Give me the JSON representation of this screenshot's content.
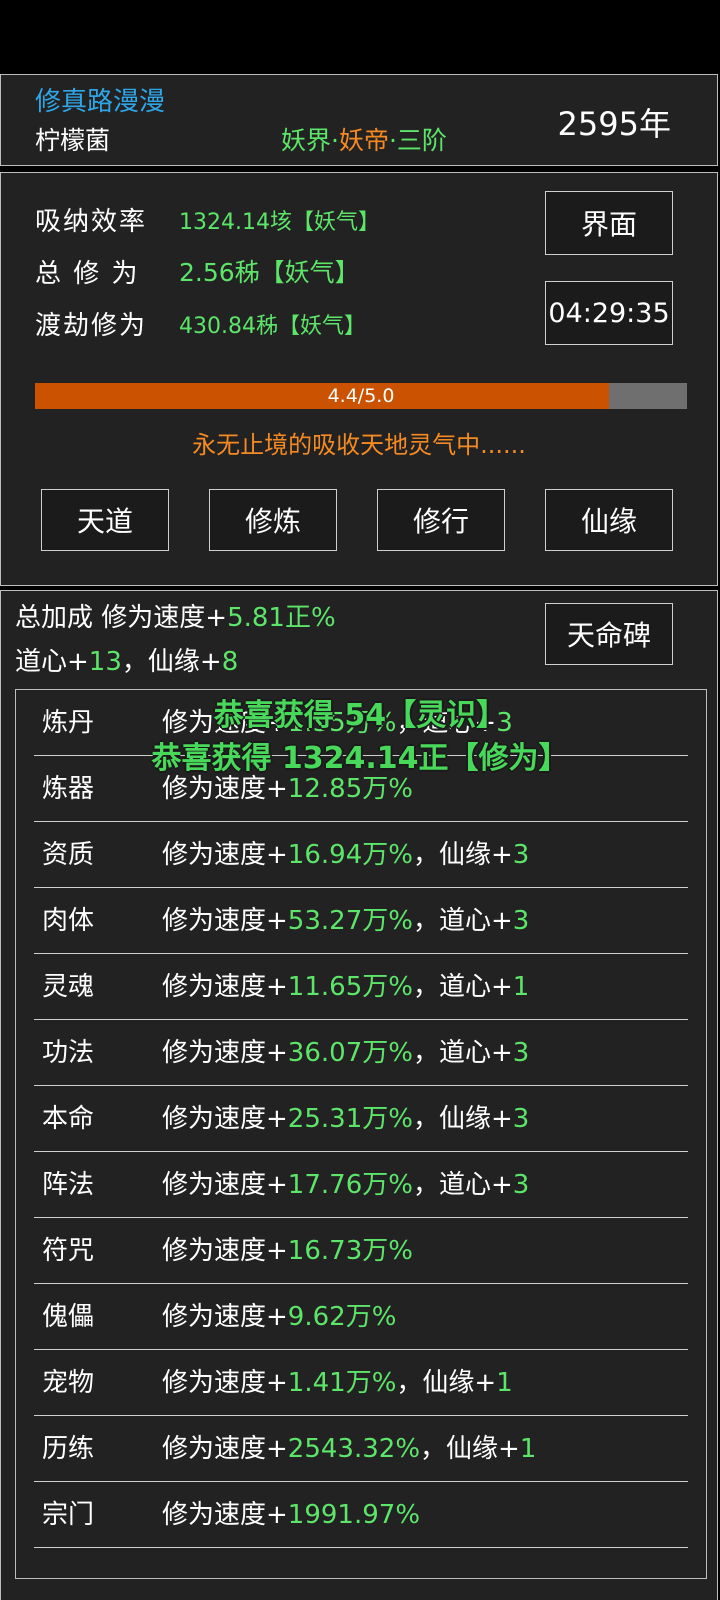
{
  "header": {
    "game_title": "修真路漫漫",
    "player_name": "柠檬菌",
    "realm_prefix": "妖界·",
    "realm_title": "妖帝",
    "realm_suffix": "·三阶",
    "year": "2595年"
  },
  "stats": {
    "absorb_label": "吸纳效率",
    "absorb_value": "1324.14垓【妖气】",
    "total_label": "总 修 为",
    "total_value": "2.56秭【妖气】",
    "tribulation_label": "渡劫修为",
    "tribulation_value": "430.84秭【妖气】",
    "interface_button": "界面",
    "timer": "04:29:35",
    "progress_text": "4.4/5.0",
    "progress_fraction": 0.88,
    "status_message": "永无止境的吸收天地灵气中......"
  },
  "actions": [
    "天道",
    "修炼",
    "修行",
    "仙缘"
  ],
  "bonus": {
    "line1_prefix": "总加成 修为速度+",
    "line1_value": "5.81正%",
    "line2_a": "道心+",
    "line2_a_value": "13",
    "line2_b": "，仙缘+",
    "line2_b_value": "8",
    "fate_button": "天命碑"
  },
  "rows": [
    {
      "name": "炼丹",
      "prefix": "修为速度+",
      "value": "1.35万%",
      "extra_label": "，道心+",
      "extra_value": "3"
    },
    {
      "name": "炼器",
      "prefix": "修为速度+",
      "value": "12.85万%",
      "extra_label": "",
      "extra_value": ""
    },
    {
      "name": "资质",
      "prefix": "修为速度+",
      "value": "16.94万%",
      "extra_label": "，仙缘+",
      "extra_value": "3"
    },
    {
      "name": "肉体",
      "prefix": "修为速度+",
      "value": "53.27万%",
      "extra_label": "，道心+",
      "extra_value": "3"
    },
    {
      "name": "灵魂",
      "prefix": "修为速度+",
      "value": "11.65万%",
      "extra_label": "，道心+",
      "extra_value": "1"
    },
    {
      "name": "功法",
      "prefix": "修为速度+",
      "value": "36.07万%",
      "extra_label": "，道心+",
      "extra_value": "3"
    },
    {
      "name": "本命",
      "prefix": "修为速度+",
      "value": "25.31万%",
      "extra_label": "，仙缘+",
      "extra_value": "3"
    },
    {
      "name": "阵法",
      "prefix": "修为速度+",
      "value": "17.76万%",
      "extra_label": "，道心+",
      "extra_value": "3"
    },
    {
      "name": "符咒",
      "prefix": "修为速度+",
      "value": "16.73万%",
      "extra_label": "",
      "extra_value": ""
    },
    {
      "name": "傀儡",
      "prefix": "修为速度+",
      "value": "9.62万%",
      "extra_label": "",
      "extra_value": ""
    },
    {
      "name": "宠物",
      "prefix": "修为速度+",
      "value": "1.41万%",
      "extra_label": "，仙缘+",
      "extra_value": "1"
    },
    {
      "name": "历练",
      "prefix": "修为速度+",
      "value": "2543.32%",
      "extra_label": "，仙缘+",
      "extra_value": "1"
    },
    {
      "name": "宗门",
      "prefix": "修为速度+",
      "value": "1991.97%",
      "extra_label": "",
      "extra_value": ""
    }
  ],
  "toasts": [
    "恭喜获得 54【灵识】",
    "恭喜获得 1324.14正【修为】"
  ],
  "colors": {
    "green": "#5de56a",
    "orange": "#f58a23",
    "progress_fill": "#cb5200",
    "title_blue": "#2fa6e8"
  }
}
